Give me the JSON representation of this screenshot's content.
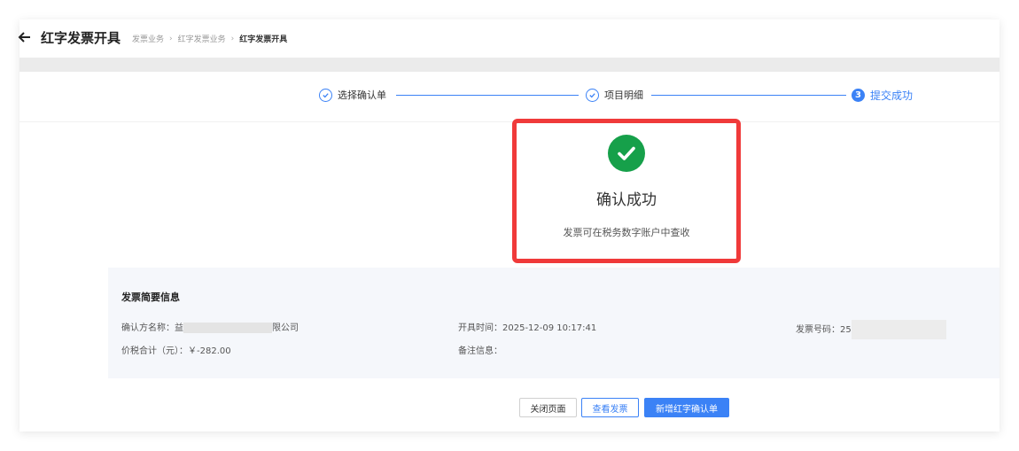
{
  "header": {
    "title": "红字发票开具",
    "breadcrumb": [
      "发票业务",
      "红字发票业务",
      "红字发票开具"
    ]
  },
  "steps": [
    {
      "label": "选择确认单",
      "state": "done"
    },
    {
      "label": "项目明细",
      "state": "done"
    },
    {
      "label": "提交成功",
      "state": "current",
      "number": "3"
    }
  ],
  "result": {
    "title": "确认成功",
    "subtitle": "发票可在税务数字账户中查收"
  },
  "summary": {
    "title": "发票简要信息",
    "confirm_party_label": "确认方名称：",
    "confirm_party_prefix": "益",
    "confirm_party_suffix": "限公司",
    "issue_time_label": "开具时间：",
    "issue_time_value": "2025-12-09 10:17:41",
    "invoice_no_label": "发票号码：",
    "invoice_no_prefix": "25",
    "total_label": "价税合计（元）：",
    "total_value": "￥-282.00",
    "remark_label": "备注信息："
  },
  "buttons": {
    "close": "关闭页面",
    "view": "查看发票",
    "new": "新增红字确认单"
  },
  "colors": {
    "accent": "#3b82f6",
    "success": "#16a04a",
    "highlight": "#f03a3a"
  }
}
